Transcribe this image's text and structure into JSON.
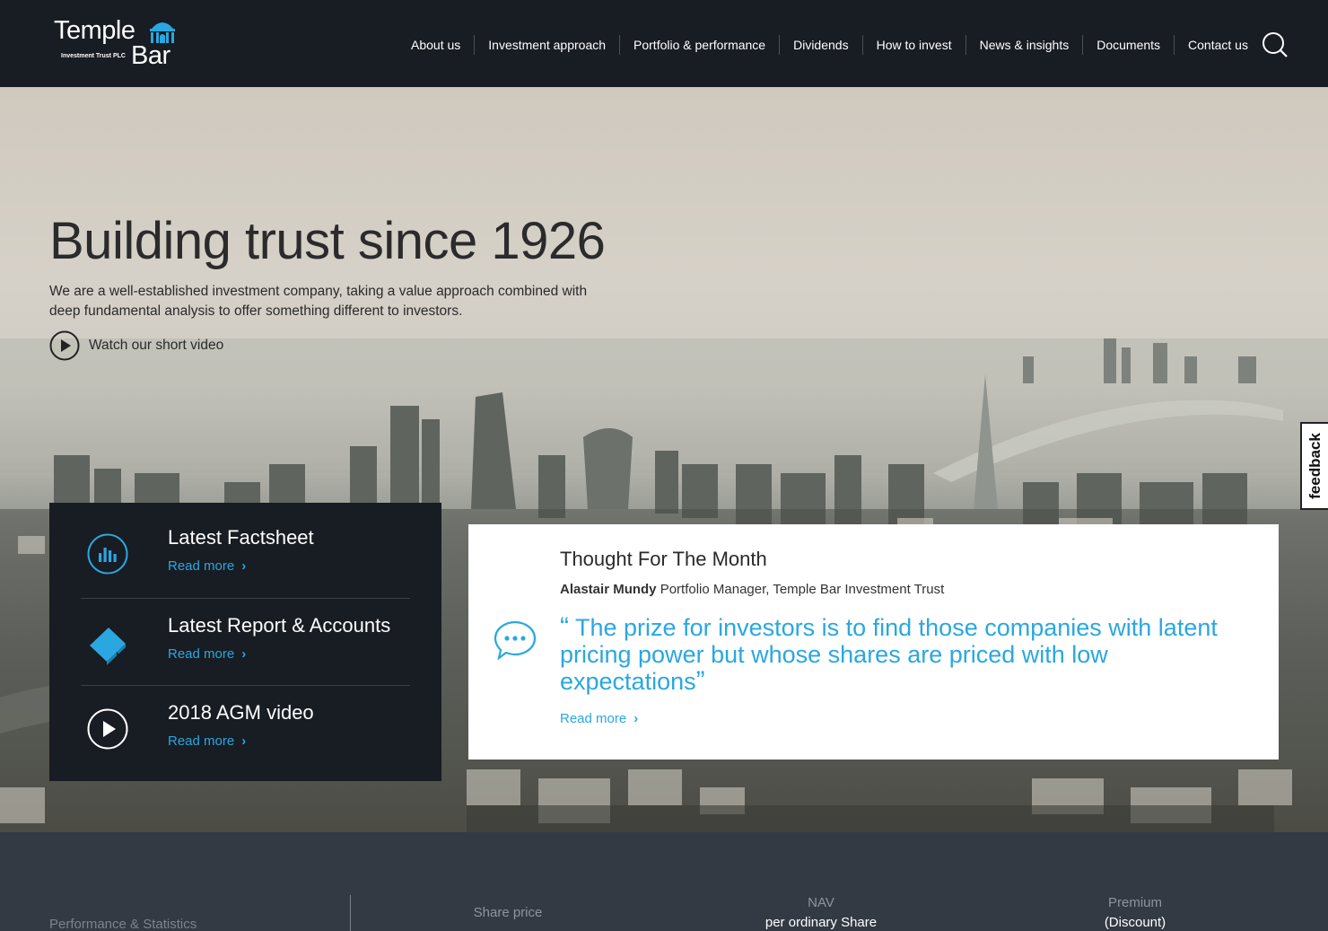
{
  "brand": {
    "name_top": "Temple",
    "name_bottom": "Bar",
    "tagline": "Investment Trust PLC"
  },
  "nav": [
    "About us",
    "Investment approach",
    "Portfolio & performance",
    "Dividends",
    "How to invest",
    "News & insights",
    "Documents",
    "Contact us"
  ],
  "hero": {
    "title": "Building trust since 1926",
    "subtitle": "We are a well-established investment company, taking a value approach combined with deep fundamental analysis to offer something different to investors.",
    "video_link": "Watch our short video"
  },
  "panel": [
    {
      "title": "Latest Factsheet",
      "link": "Read more",
      "icon": "bar-chart-icon"
    },
    {
      "title": "Latest Report & Accounts",
      "link": "Read more",
      "icon": "book-icon"
    },
    {
      "title": "2018 AGM video",
      "link": "Read more",
      "icon": "play-icon"
    }
  ],
  "thought": {
    "title": "Thought For The Month",
    "author_name": "Alastair Mundy",
    "author_role": "Portfolio Manager, Temple Bar Investment Trust",
    "open_quote": "“",
    "close_quote": "”",
    "quote": "The prize for investors is to find those companies with latent pricing power but whose shares are priced with low expectations",
    "link": "Read more"
  },
  "feedback": "feedback",
  "stats": {
    "label": "Performance & Statistics",
    "share_price": "Share price",
    "nav_top": "NAV",
    "nav_bottom": "per ordinary Share",
    "premium_top": "Premium",
    "premium_bottom": "(Discount)"
  },
  "colors": {
    "accent": "#2aa7e0",
    "header_bg": "#181c23",
    "stats_bg": "#333a44"
  }
}
